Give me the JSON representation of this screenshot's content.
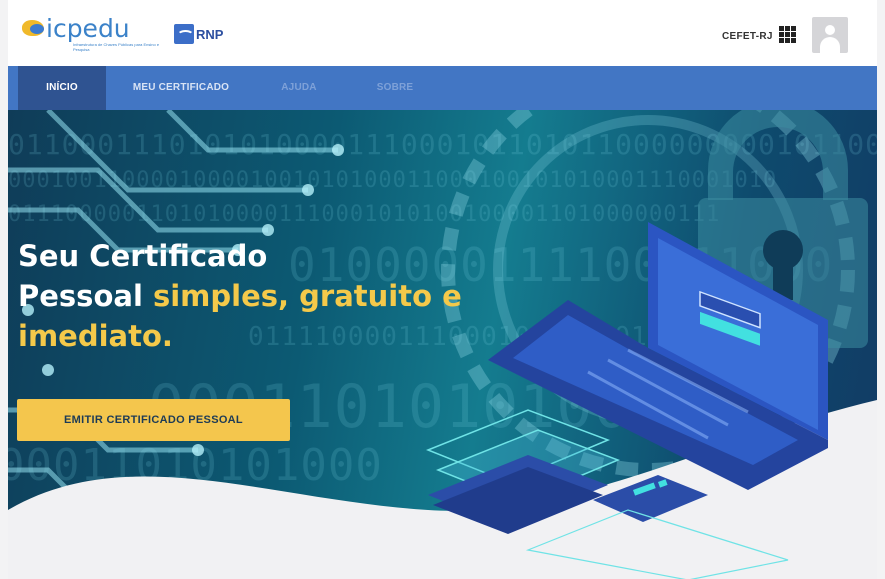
{
  "header": {
    "brand_name": "icpedu",
    "brand_tagline": "Infraestrutura de Chaves Públicas para Ensino e Pesquisa",
    "partner_logo": "RNP",
    "institution": "CEFET-RJ",
    "apps_icon": "grid-icon",
    "avatar_icon": "user-avatar-icon"
  },
  "nav": {
    "tabs": [
      {
        "label": "INÍCIO",
        "active": true
      },
      {
        "label": "MEU CERTIFICADO",
        "active": false
      },
      {
        "label": "AJUDA",
        "active": false
      },
      {
        "label": "SOBRE",
        "active": false
      }
    ]
  },
  "hero": {
    "headline_line1": "Seu Certificado",
    "headline_line2_white": "Pessoal ",
    "headline_line2_yellow": "simples, gratuito e",
    "headline_line3_yellow": "imediato.",
    "cta_label": "EMITIR CERTIFICADO PESSOAL"
  },
  "colors": {
    "nav_bg": "#4276c4",
    "nav_active": "#2f5391",
    "accent_yellow": "#f4c64d",
    "hero_dark": "#0f3c58"
  }
}
